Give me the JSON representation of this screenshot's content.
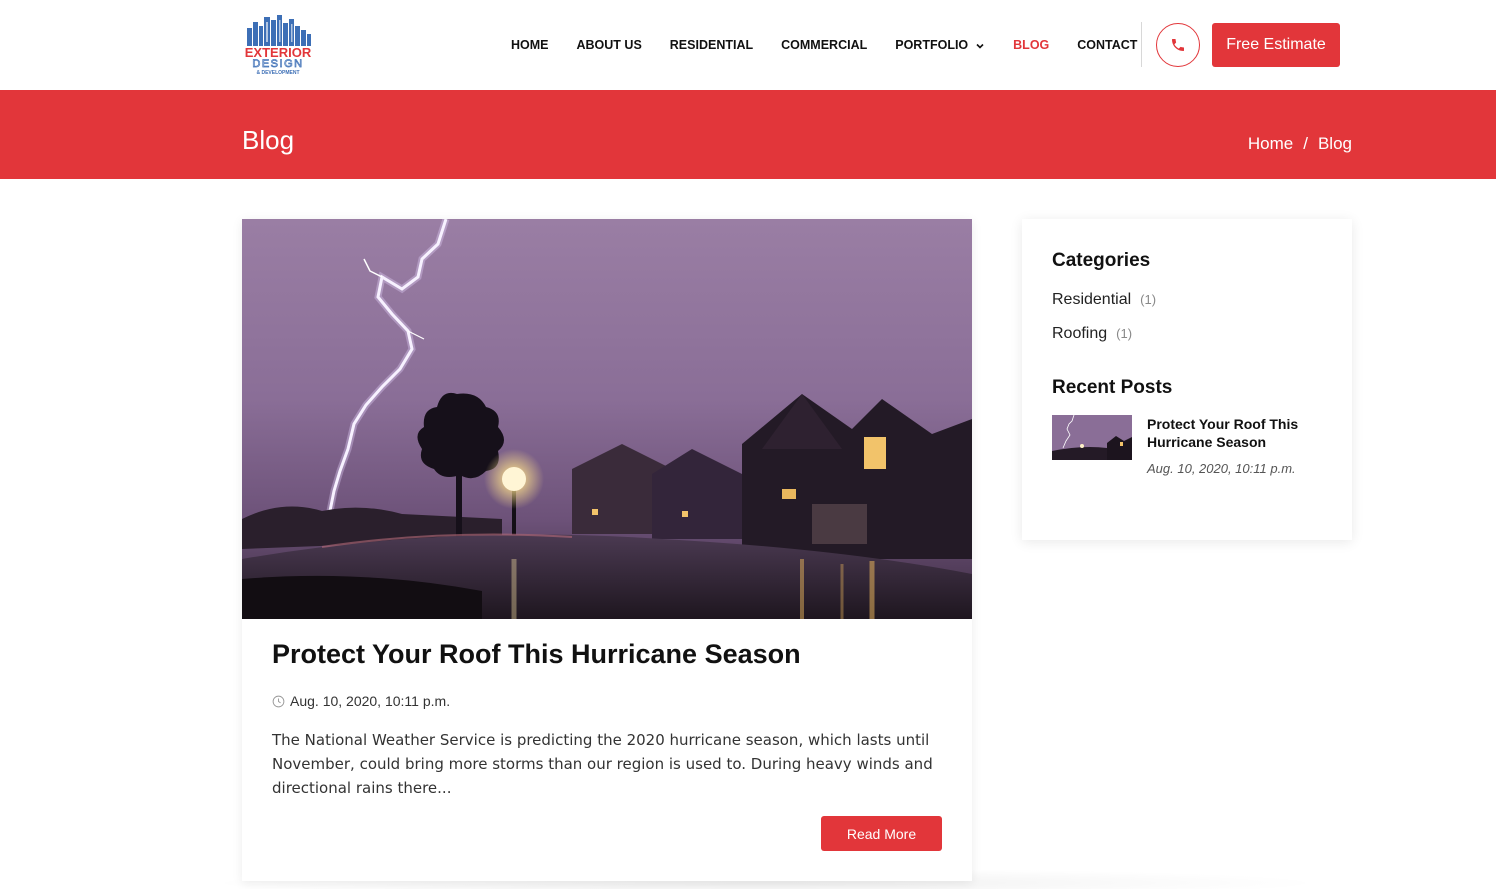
{
  "logo": {
    "line1": "EXTERIOR",
    "line2": "DESIGN",
    "line3": "& DEVELOPMENT",
    "colors": {
      "blue": "#3d6fb6",
      "red": "#e2363a"
    }
  },
  "nav": {
    "items": [
      {
        "label": "HOME"
      },
      {
        "label": "ABOUT US"
      },
      {
        "label": "RESIDENTIAL"
      },
      {
        "label": "COMMERCIAL"
      },
      {
        "label": "PORTFOLIO",
        "icon": "chevron-down-icon"
      },
      {
        "label": "BLOG",
        "active": true
      },
      {
        "label": "CONTACT"
      }
    ],
    "phone_icon": "phone-icon",
    "estimate_label": "Free Estimate"
  },
  "banner": {
    "title": "Blog",
    "breadcrumb": {
      "home": "Home",
      "separator": "/",
      "current": "Blog"
    }
  },
  "post": {
    "title": "Protect Your Roof This Hurricane Season",
    "date": "Aug. 10, 2020, 10:11 p.m.",
    "date_icon": "clock-icon",
    "excerpt": "The National Weather Service is predicting the 2020 hurricane season, which lasts until November, could bring more storms than our region is used to. During heavy winds and directional rains there...",
    "read_more": "Read More"
  },
  "sidebar": {
    "categories_heading": "Categories",
    "categories": [
      {
        "name": "Residential",
        "count": "(1)"
      },
      {
        "name": "Roofing",
        "count": "(1)"
      }
    ],
    "recent_heading": "Recent Posts",
    "recent_posts": [
      {
        "title": "Protect Your Roof This Hurricane Season",
        "date": "Aug. 10, 2020, 10:11 p.m."
      }
    ]
  },
  "colors": {
    "accent": "#e2363a",
    "text": "#111111"
  }
}
